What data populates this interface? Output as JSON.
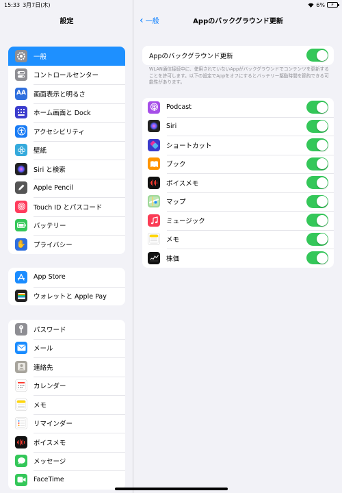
{
  "status": {
    "time": "15:33",
    "date": "3月7日(木)",
    "battery": "6%"
  },
  "sidebar": {
    "title": "設定",
    "group1": [
      {
        "label": "一般",
        "icon": "gear-icon",
        "color": "#8e8e93",
        "selected": true
      },
      {
        "label": "コントロールセンター",
        "icon": "toggles-icon",
        "color": "#8e8e93"
      },
      {
        "label": "画面表示と明るさ",
        "icon": "text-size-icon",
        "color": "#2f6fde"
      },
      {
        "label": "ホーム画面と Dock",
        "icon": "grid-icon",
        "color": "#3b3ccd"
      },
      {
        "label": "アクセシビリティ",
        "icon": "accessibility-icon",
        "color": "#1a7cf5"
      },
      {
        "label": "壁紙",
        "icon": "flower-icon",
        "color": "#35aadc"
      },
      {
        "label": "Siri と検索",
        "icon": "siri-icon",
        "color": "#222222"
      },
      {
        "label": "Apple Pencil",
        "icon": "pencil-icon",
        "color": "#555555"
      },
      {
        "label": "Touch ID とパスコード",
        "icon": "fingerprint-icon",
        "color": "#ff3b5c"
      },
      {
        "label": "バッテリー",
        "icon": "battery-icon",
        "color": "#34c759"
      },
      {
        "label": "プライバシー",
        "icon": "hand-icon",
        "color": "#2f6fde"
      }
    ],
    "group2": [
      {
        "label": "App Store",
        "icon": "app-store-icon",
        "color": "#1a8cff"
      },
      {
        "label": "ウォレットと Apple Pay",
        "icon": "wallet-icon",
        "color": "#222222"
      }
    ],
    "group3": [
      {
        "label": "パスワード",
        "icon": "key-icon",
        "color": "#8e8e93"
      },
      {
        "label": "メール",
        "icon": "mail-icon",
        "color": "#1a8cff"
      },
      {
        "label": "連絡先",
        "icon": "contacts-icon",
        "color": "#a7a49c"
      },
      {
        "label": "カレンダー",
        "icon": "calendar-icon",
        "color": "#ffffff"
      },
      {
        "label": "メモ",
        "icon": "notes-icon",
        "color": "#ffffff"
      },
      {
        "label": "リマインダー",
        "icon": "reminders-icon",
        "color": "#ffffff"
      },
      {
        "label": "ボイスメモ",
        "icon": "voice-memo-icon",
        "color": "#111111"
      },
      {
        "label": "メッセージ",
        "icon": "messages-icon",
        "color": "#34c759"
      },
      {
        "label": "FaceTime",
        "icon": "facetime-icon",
        "color": "#34c759"
      }
    ]
  },
  "main": {
    "back_label": "一般",
    "title": "Appのバックグラウンド更新",
    "master_label": "Appのバックグラウンド更新",
    "master_on": true,
    "footnote": "WLAN通信接続中に、使用されていないAppがバックグラウンドでコンテンツを更新することを許可します。以下の設定でAppをオフにするとバッテリー駆動時間を節約できる可能性があります。",
    "apps": [
      {
        "label": "Podcast",
        "icon": "podcast-icon",
        "color": "#a64ee8",
        "on": true
      },
      {
        "label": "Siri",
        "icon": "siri-icon",
        "color": "#222222",
        "on": true
      },
      {
        "label": "ショートカット",
        "icon": "shortcuts-icon",
        "color": "#3a3acb",
        "on": true
      },
      {
        "label": "ブック",
        "icon": "books-icon",
        "color": "#ff9500",
        "on": true
      },
      {
        "label": "ボイスメモ",
        "icon": "voice-memo-icon",
        "color": "#111111",
        "on": true
      },
      {
        "label": "マップ",
        "icon": "maps-icon",
        "color": "#9fd89a",
        "on": true
      },
      {
        "label": "ミュージック",
        "icon": "music-icon",
        "color": "#fa3c55",
        "on": true
      },
      {
        "label": "メモ",
        "icon": "notes-icon",
        "color": "#ffffff",
        "on": true
      },
      {
        "label": "株価",
        "icon": "stocks-icon",
        "color": "#111111",
        "on": true
      }
    ]
  },
  "colors": {
    "accent": "#007aff",
    "toggle_on": "#34c759",
    "selected_row": "#1e90ff"
  }
}
